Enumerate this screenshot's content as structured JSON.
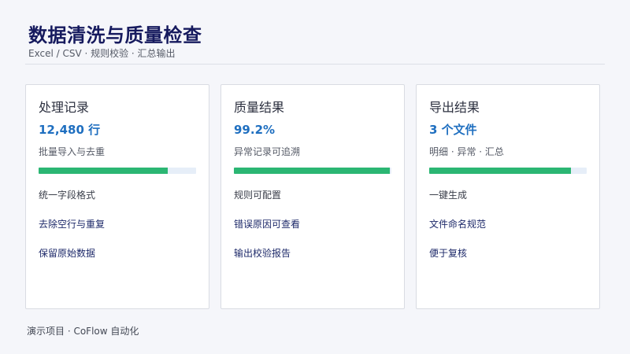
{
  "header": {
    "title": "数据清洗与质量检查",
    "subtitle": "Excel / CSV · 规则校验 · 汇总输出"
  },
  "cards": [
    {
      "title": "处理记录",
      "value": "12,480 行",
      "desc": "批量导入与去重",
      "progress": 0.82,
      "items": [
        "统一字段格式",
        "去除空行与重复",
        "保留原始数据"
      ]
    },
    {
      "title": "质量结果",
      "value": "99.2%",
      "desc": "异常记录可追溯",
      "progress": 0.992,
      "items": [
        "规则可配置",
        "错误原因可查看",
        "输出校验报告"
      ]
    },
    {
      "title": "导出结果",
      "value": "3 个文件",
      "desc": "明细 · 异常 · 汇总",
      "progress": 0.9,
      "items": [
        "一键生成",
        "文件命名规范",
        "便于复核"
      ]
    }
  ],
  "colors": {
    "title": "#161a5e",
    "value": "#1f6fc0",
    "bar_fill": "#2bb673",
    "bar_track": "#e6eef8"
  },
  "footer": {
    "text": "演示项目 · CoFlow 自动化"
  }
}
